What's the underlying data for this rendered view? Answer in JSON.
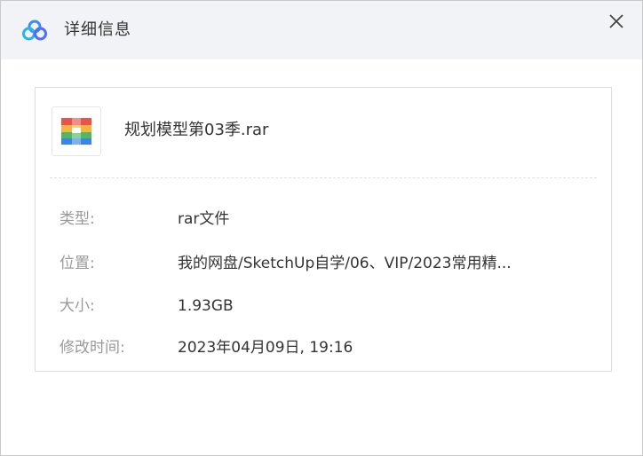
{
  "dialog": {
    "title": "详细信息",
    "close_icon": "close-icon",
    "app_icon": "baidu-netdisk-logo-icon"
  },
  "file": {
    "name": "规划模型第03季.rar",
    "icon": "rar-archive-icon"
  },
  "details": [
    {
      "label": "类型:",
      "value": "rar文件"
    },
    {
      "label": "位置:",
      "value": "我的网盘/SketchUp自学/06、VIP/2023常用精..."
    },
    {
      "label": "大小:",
      "value": "1.93GB"
    },
    {
      "label": "修改时间:",
      "value": "2023年04月09日, 19:16"
    }
  ],
  "colors": {
    "titlebar_bg": "#f2f3f7",
    "label_text": "#999999",
    "value_text": "#333333"
  }
}
